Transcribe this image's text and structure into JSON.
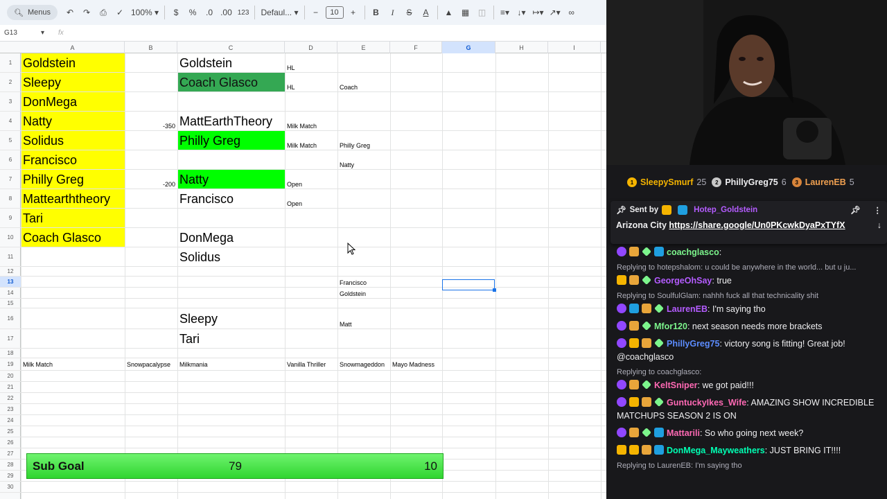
{
  "toolbar": {
    "menus_label": "Menus",
    "zoom": "100%",
    "currency": "$",
    "percent": "%",
    "dec_less": ".0",
    "dec_more": ".00",
    "format_123": "123",
    "font": "Defaul...",
    "font_size": "10"
  },
  "formula_bar": {
    "cell_ref": "G13",
    "fx": "fx"
  },
  "columns": [
    "A",
    "B",
    "C",
    "D",
    "E",
    "F",
    "G",
    "H",
    "I"
  ],
  "rows": [
    "1",
    "2",
    "3",
    "4",
    "5",
    "6",
    "7",
    "8",
    "9",
    "10",
    "11",
    "12",
    "13",
    "14",
    "15",
    "16",
    "17",
    "18",
    "19",
    "20",
    "21",
    "22",
    "23",
    "24",
    "25",
    "26",
    "27",
    "28",
    "29",
    "30"
  ],
  "cells": {
    "A1": "Goldstein",
    "A2": "Sleepy",
    "A3": "DonMega",
    "A4": "Natty",
    "A5": "Solidus",
    "A6": "Francisco",
    "A7": "Philly Greg",
    "A8": "Mattearththeory",
    "A9": "Tari",
    "A10": "Coach Glasco",
    "B4": "-350",
    "B7": "-200",
    "C1": "Goldstein",
    "C2": "Coach Glasco",
    "C4": "MattEarthTheory",
    "C5": "Philly Greg",
    "C7": "Natty",
    "C8": "Francisco",
    "C10": "DonMega",
    "C11": "Solidus",
    "C16": "Sleepy",
    "C17": "Tari",
    "D1": "HL",
    "D2": "HL",
    "D4": "Milk Match",
    "D5": "Milk Match",
    "D7": "Open",
    "D8": "Open",
    "E2": "Coach",
    "E5": "Philly Greg",
    "E6": "Natty",
    "E13": "Francisco",
    "E14": "Goldstein",
    "E16": "Matt",
    "A19": "Milk Match",
    "B19": "Snowpacalypse",
    "C19": "Milkmania",
    "D19": "Vanilla Thriller",
    "E19": "Snowmageddon",
    "F19": "Mayo Madness"
  },
  "sub_goal": {
    "label": "Sub Goal",
    "current": "79",
    "target": "10"
  },
  "colors": {
    "yellow": "#ffff00",
    "green": "#00ff00",
    "dark_green": "#34a853",
    "chat_bg": "#18181b"
  },
  "chat": {
    "leaderboard": [
      {
        "rank": "1",
        "name": "SleepySmurf",
        "count": "25"
      },
      {
        "rank": "2",
        "name": "PhillyGreg75",
        "count": "6"
      },
      {
        "rank": "3",
        "name": "LaurenEB",
        "count": "5"
      }
    ],
    "pinned": {
      "sent_by": "Sent by",
      "user": "Hotep_Goldstein",
      "text": "Arizona City",
      "link": "https://share.google/Un0PKcwkDyaPxTYfX"
    },
    "messages": [
      {
        "reply": "",
        "user": "coachglasco",
        "text": "",
        "color": "#7cf58c"
      },
      {
        "reply": "Replying to hotepshalom: u could be anywhere in the world... but u ju...",
        "user": "GeorgeOhSay",
        "text": "true",
        "color": "#b45cff"
      },
      {
        "reply": "Replying to SoulfulGlam: nahhh fuck all that technicality shit",
        "user": "LaurenEB",
        "text": "I'm saying tho",
        "color": "#b45cff"
      },
      {
        "reply": "",
        "user": "Mfor120",
        "text": "next season needs more brackets",
        "color": "#7cf58c"
      },
      {
        "reply": "",
        "user": "PhillyGreg75",
        "text": "victory song is fitting! Great job! @coachglasco",
        "color": "#5c8cff"
      },
      {
        "reply": "Replying to coachglasco:",
        "user": "KeltSniper",
        "text": "we got paid!!!",
        "color": "#ff69b4"
      },
      {
        "reply": "",
        "user": "GuntuckyIkes_Wife",
        "text": "AMAZING SHOW INCREDIBLE MATCHUPS SEASON 2 IS ON",
        "color": "#ff69b4"
      },
      {
        "reply": "",
        "user": "Mattarili",
        "text": "So who going next week?",
        "color": "#ff69b4"
      },
      {
        "reply": "",
        "user": "DonMega_Mayweathers",
        "text": "JUST BRING IT!!!!",
        "color": "#00ffb3"
      },
      {
        "reply": "Replying to LaurenEB: I'm saying tho",
        "user": "",
        "text": "",
        "color": "#adadb8"
      }
    ]
  }
}
